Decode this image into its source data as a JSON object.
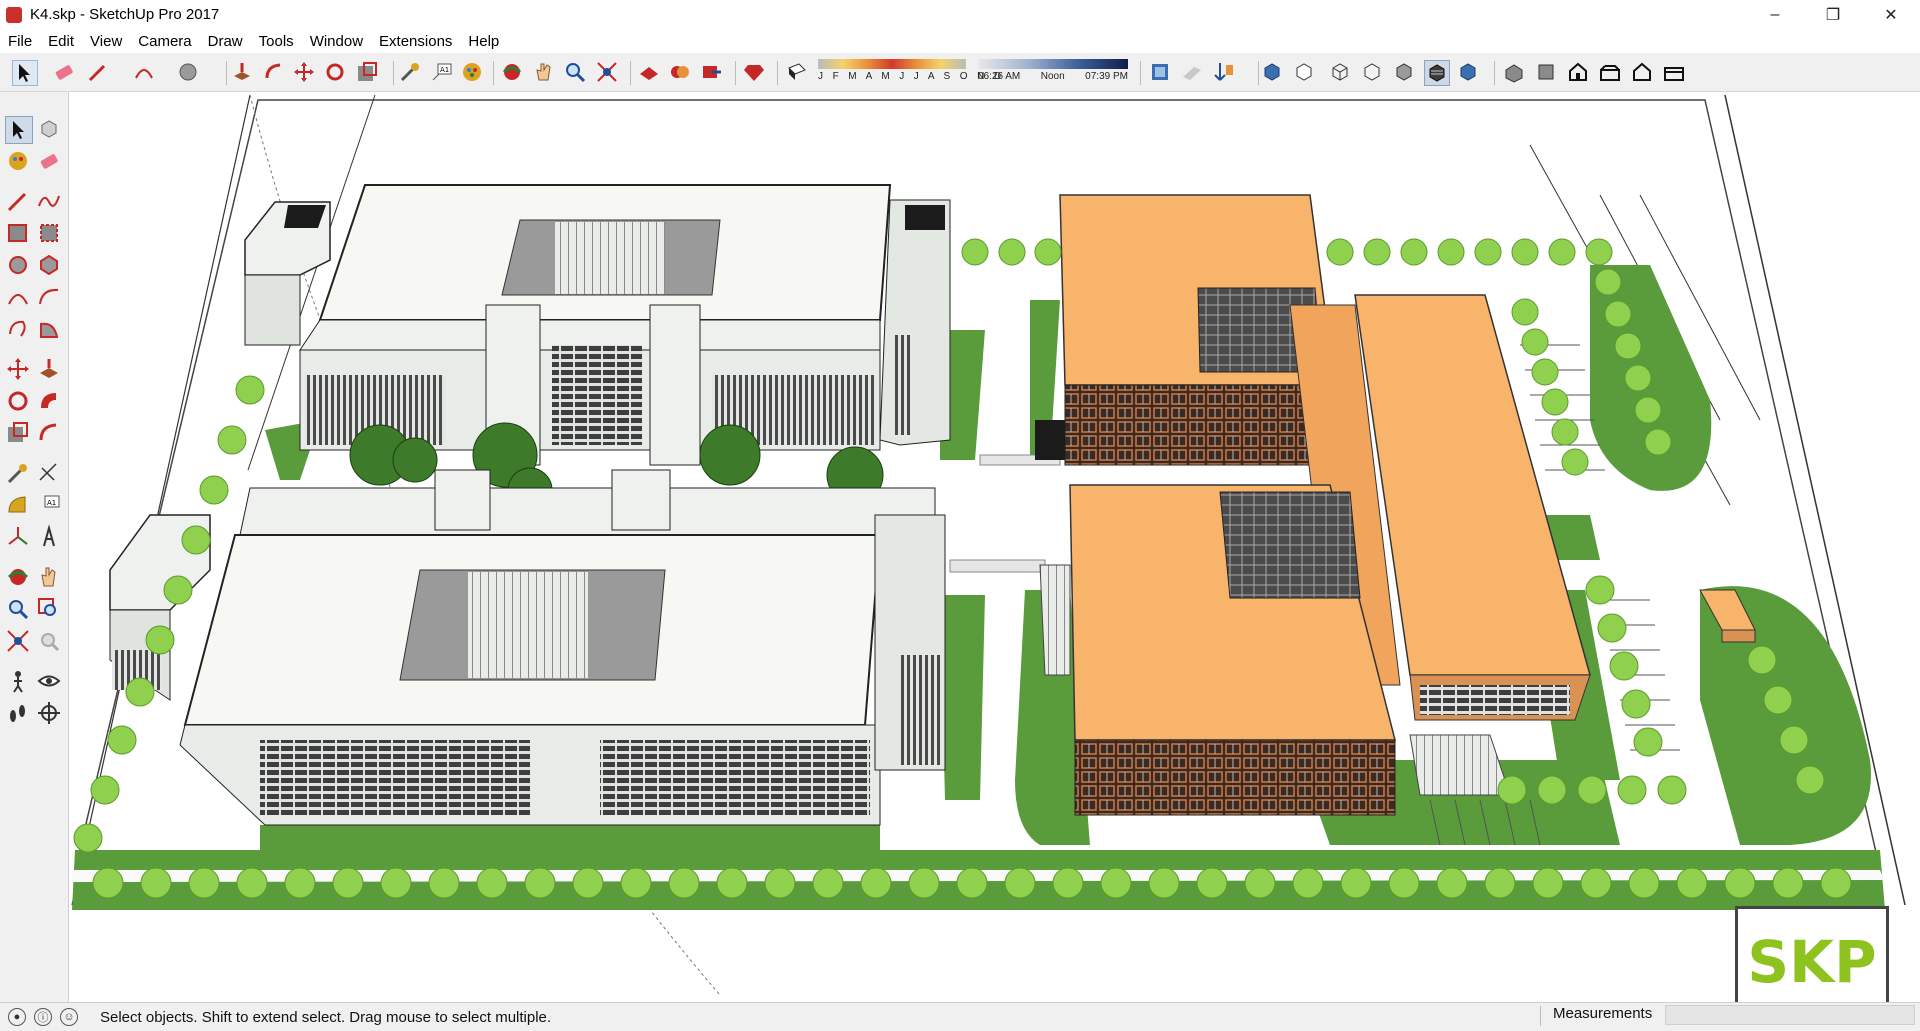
{
  "window": {
    "title": "K4.skp - SketchUp Pro 2017",
    "minimize_icon": "minimize-icon",
    "maximize_icon": "restore-icon",
    "close_icon": "close-icon"
  },
  "menu": {
    "items": [
      "File",
      "Edit",
      "View",
      "Camera",
      "Draw",
      "Tools",
      "Window",
      "Extensions",
      "Help"
    ]
  },
  "shadows": {
    "months": "J F M A M J J A S O N D",
    "sunrise": "06:26 AM",
    "noon": "Noon",
    "sunset": "07:39 PM"
  },
  "status": {
    "message": "Select objects. Shift to extend select. Drag mouse to select multiple.",
    "measurements_label": "Measurements",
    "measurements_value": ""
  },
  "watermark": {
    "text": "SKP"
  },
  "colors": {
    "orange_building": "#f9b46b",
    "white_building": "#f7f7f3",
    "lawn": "#5a9b3c",
    "tree": "#8fd14f",
    "skp_green": "#8dc21f"
  }
}
